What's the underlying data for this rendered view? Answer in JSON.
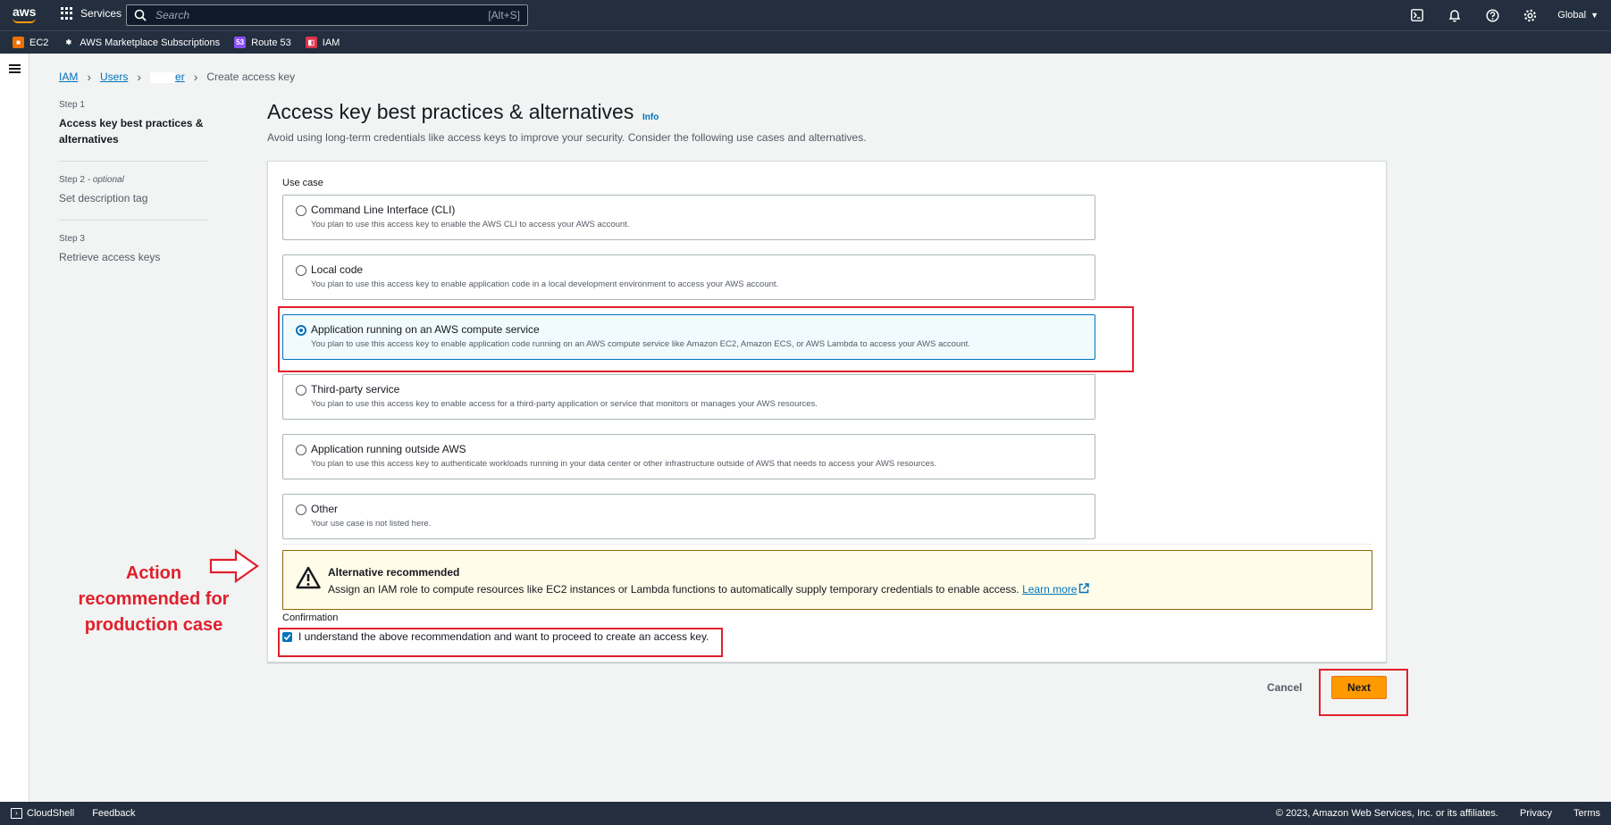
{
  "topnav": {
    "logo_text": "aws",
    "services_label": "Services",
    "search_placeholder": "Search",
    "search_shortcut": "[Alt+S]",
    "region_label": "Global"
  },
  "favorites": [
    {
      "label": "EC2",
      "icon_color": "#ed7100",
      "icon_glyph": "■"
    },
    {
      "label": "AWS Marketplace Subscriptions",
      "icon_color": "#232f3e",
      "icon_glyph": "✱"
    },
    {
      "label": "Route 53",
      "icon_color": "#8c4fff",
      "icon_glyph": "53"
    },
    {
      "label": "IAM",
      "icon_color": "#dd344c",
      "icon_glyph": "◧"
    }
  ],
  "breadcrumb": {
    "iam": "IAM",
    "users": "Users",
    "user_partial": "er",
    "current": "Create access key"
  },
  "steps": [
    {
      "number": "Step 1",
      "optional": "",
      "name": "Access key best practices & alternatives",
      "active": true
    },
    {
      "number": "Step 2 - ",
      "optional": "optional",
      "name": "Set description tag",
      "active": false
    },
    {
      "number": "Step 3",
      "optional": "",
      "name": "Retrieve access keys",
      "active": false
    }
  ],
  "page": {
    "title": "Access key best practices & alternatives",
    "info_link": "Info",
    "subtitle": "Avoid using long-term credentials like access keys to improve your security. Consider the following use cases and alternatives."
  },
  "use_case": {
    "label": "Use case",
    "options": [
      {
        "title": "Command Line Interface (CLI)",
        "description": "You plan to use this access key to enable the AWS CLI to access your AWS account.",
        "selected": false
      },
      {
        "title": "Local code",
        "description": "You plan to use this access key to enable application code in a local development environment to access your AWS account.",
        "selected": false
      },
      {
        "title": "Application running on an AWS compute service",
        "description": "You plan to use this access key to enable application code running on an AWS compute service like Amazon EC2, Amazon ECS, or AWS Lambda to access your AWS account.",
        "selected": true
      },
      {
        "title": "Third-party service",
        "description": "You plan to use this access key to enable access for a third-party application or service that monitors or manages your AWS resources.",
        "selected": false
      },
      {
        "title": "Application running outside AWS",
        "description": "You plan to use this access key to authenticate workloads running in your data center or other infrastructure outside of AWS that needs to access your AWS resources.",
        "selected": false
      },
      {
        "title": "Other",
        "description": "Your use case is not listed here.",
        "selected": false
      }
    ]
  },
  "alert": {
    "title": "Alternative recommended",
    "text": "Assign an IAM role to compute resources like EC2 instances or Lambda functions to automatically supply temporary credentials to enable access. ",
    "link": "Learn more"
  },
  "confirmation": {
    "label": "Confirmation",
    "checkbox_label": "I understand the above recommendation and want to proceed to create an access key.",
    "checked": true
  },
  "actions": {
    "cancel": "Cancel",
    "next": "Next"
  },
  "annotation": {
    "text_line1": "Action",
    "text_line2": "recommended for",
    "text_line3": "production case",
    "color": "#e0202c"
  },
  "footer": {
    "cloudshell": "CloudShell",
    "feedback": "Feedback",
    "copyright": "© 2023, Amazon Web Services, Inc. or its affiliates.",
    "privacy": "Privacy",
    "terms": "Terms"
  }
}
